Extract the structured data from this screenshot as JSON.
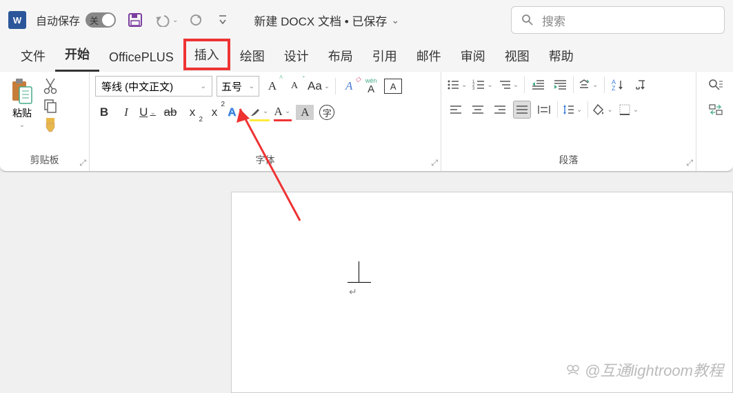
{
  "titlebar": {
    "autosave_label": "自动保存",
    "autosave_state": "关",
    "doc_title": "新建 DOCX 文档 • 已保存",
    "search_placeholder": "搜索"
  },
  "tabs": {
    "file": "文件",
    "home": "开始",
    "officeplus": "OfficePLUS",
    "insert": "插入",
    "draw": "绘图",
    "design": "设计",
    "layout": "布局",
    "references": "引用",
    "mailings": "邮件",
    "review": "审阅",
    "view": "视图",
    "help": "帮助"
  },
  "groups": {
    "clipboard": {
      "label": "剪贴板",
      "paste": "粘贴"
    },
    "font": {
      "label": "字体",
      "name": "等线 (中文正文)",
      "size": "五号",
      "pinyin": "wén",
      "char_A": "A",
      "char_zi": "字"
    },
    "paragraph": {
      "label": "段落"
    }
  },
  "icons": {
    "word": "W"
  },
  "watermark": "@互通lightroom教程"
}
